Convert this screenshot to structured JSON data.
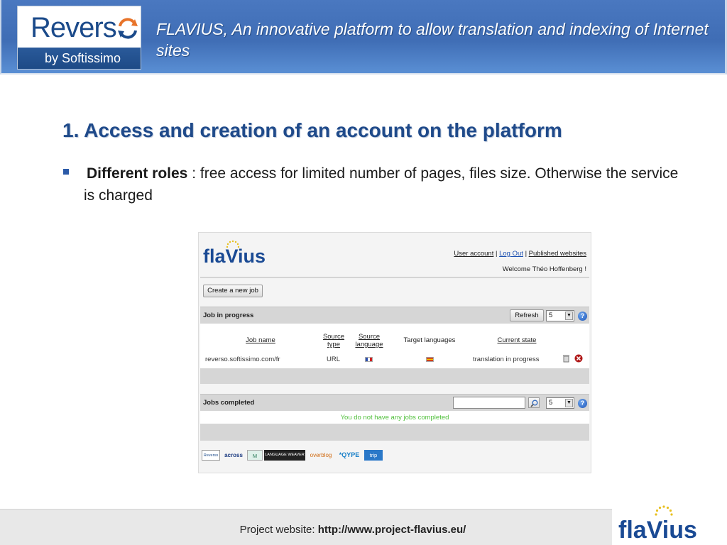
{
  "header": {
    "logo_word": "Revers",
    "logo_tagline": "by Softissimo",
    "title": "FLAVIUS, An innovative platform to allow translation and indexing of Internet sites"
  },
  "slide": {
    "title": "1. Access and creation of an account on the platform",
    "bullet_bold": "Different roles",
    "bullet_text": " : free access for limited number of pages, files size. Otherwise the service is charged"
  },
  "screenshot": {
    "logo_left": "fla",
    "logo_v": "V",
    "logo_right": "ius",
    "links": {
      "user_account": "User account",
      "separator": "|",
      "log_out": "Log Out",
      "published": "Published websites"
    },
    "welcome": "Welcome Théo Hoffenberg !",
    "create_job_label": "Create a new job",
    "jobs_in_progress": {
      "title": "Job in progress",
      "refresh_label": "Refresh",
      "page_size": "5",
      "help": "?",
      "columns": {
        "job_name": "Job name",
        "source_type_1": "Source",
        "source_type_2": "type",
        "source_lang_1": "Source",
        "source_lang_2": "language",
        "target_languages": "Target languages",
        "current_state": "Current state"
      },
      "rows": [
        {
          "job_name": "reverso.softissimo.com/fr",
          "source_type": "URL",
          "current_state": "translation in progress"
        }
      ]
    },
    "jobs_completed": {
      "title": "Jobs completed",
      "page_size": "5",
      "help": "?",
      "empty_message": "You do not have any jobs completed"
    },
    "partners": [
      "Reverso",
      "across",
      "M",
      "LANGUAGE WEAVER",
      "overblog",
      "*QYPE",
      "trip"
    ]
  },
  "footer": {
    "label": "Project website: ",
    "url": "http://www.project-flavius.eu/",
    "logo_left": "fla",
    "logo_v": "V",
    "logo_right": "ius"
  },
  "colors": {
    "brand_blue": "#1a4a94",
    "header_blue": "#4a78c0",
    "success_green": "#4fbf3a"
  }
}
